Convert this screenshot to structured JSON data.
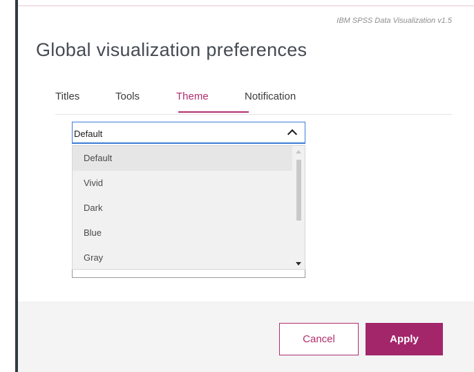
{
  "dialog": {
    "version": "IBM SPSS Data Visualization v1.5",
    "title": "Global visualization preferences"
  },
  "tabs": [
    {
      "label": "Titles",
      "active": false
    },
    {
      "label": "Tools",
      "active": false
    },
    {
      "label": "Theme",
      "active": true
    },
    {
      "label": "Notification",
      "active": false
    }
  ],
  "theme_select": {
    "value": "Default",
    "expanded": true,
    "options": [
      "Default",
      "Vivid",
      "Dark",
      "Blue",
      "Gray"
    ],
    "selected_index": 0
  },
  "buttons": {
    "cancel": "Cancel",
    "apply": "Apply"
  },
  "colors": {
    "accent": "#b02e6e",
    "apply_bg": "#a3266a",
    "focus_border": "#3a7bd5"
  },
  "icons": {
    "select_toggle": "chevron-up-icon",
    "scroll_up": "scroll-up-arrow-icon",
    "scroll_down": "scroll-down-arrow-icon"
  }
}
